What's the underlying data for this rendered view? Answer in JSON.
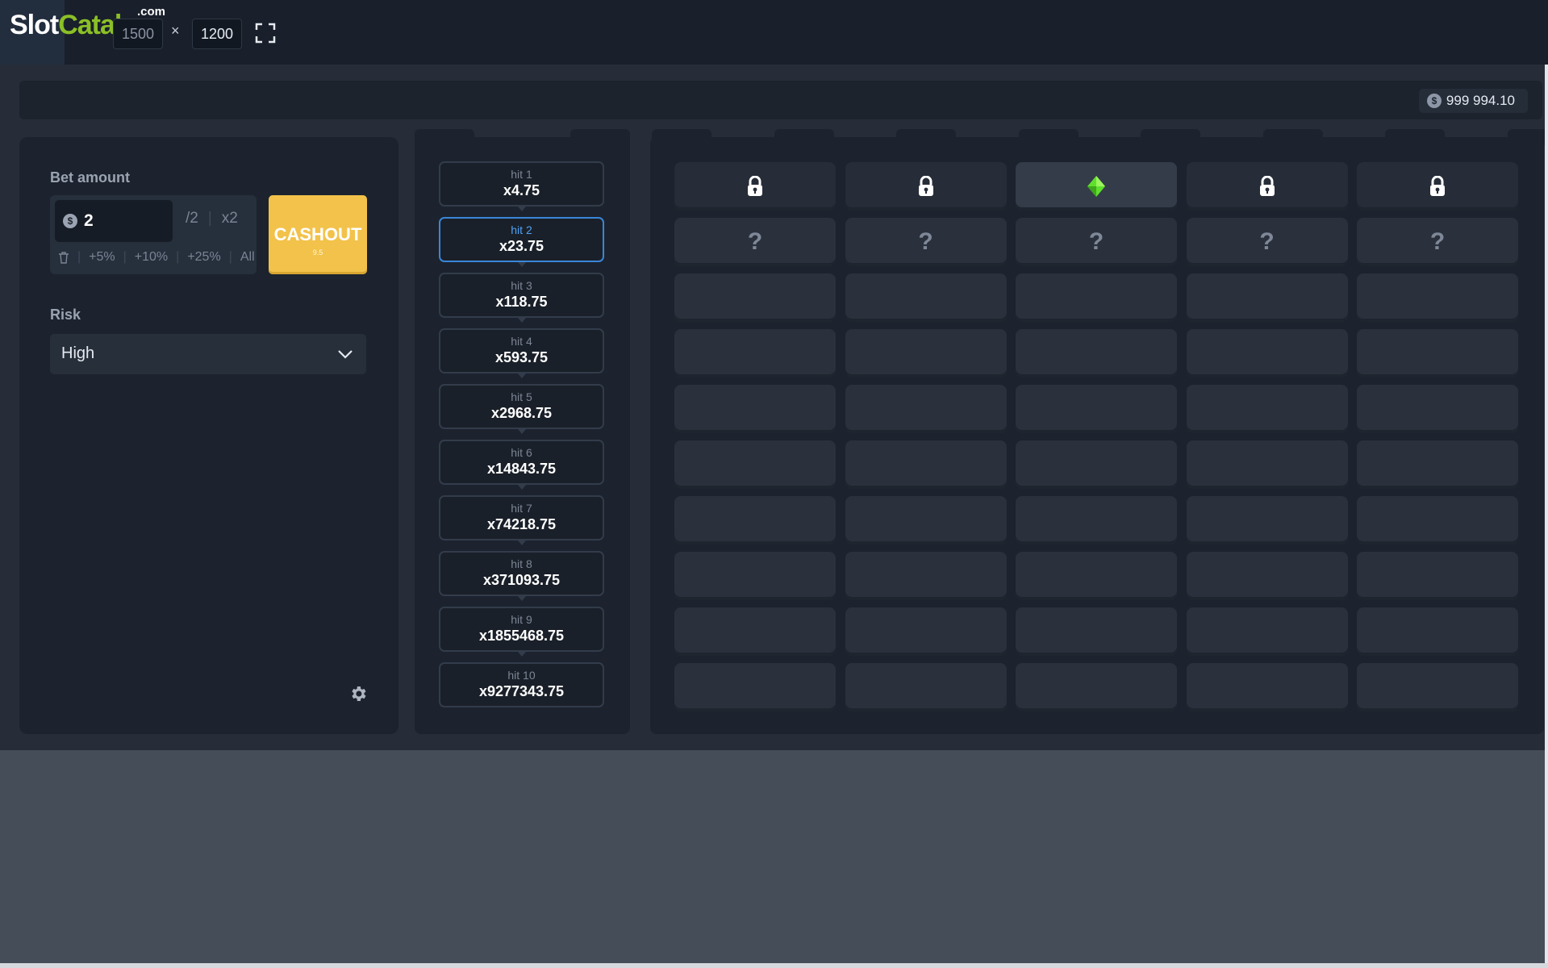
{
  "topbar": {
    "logo_slot": "Slot",
    "logo_catalog": "Catalog",
    "logo_dotcom": ".com",
    "width_value": "1500",
    "times": "×",
    "height_value": "1200",
    "fullscreen_icon": "fullscreen-icon"
  },
  "header": {
    "currency_symbol": "$",
    "balance": "999 994.10"
  },
  "bet": {
    "label": "Bet amount",
    "currency_symbol": "$",
    "amount": "2",
    "half_label": "/2",
    "double_label": "x2",
    "pct5": "+5%",
    "pct10": "+10%",
    "pct25": "+25%",
    "all": "All",
    "cashout_label": "CASHOUT",
    "cashout_sub": "9.5"
  },
  "risk": {
    "label": "Risk",
    "selected": "High"
  },
  "hits": [
    {
      "label": "hit 1",
      "mult": "x4.75"
    },
    {
      "label": "hit 2",
      "mult": "x23.75"
    },
    {
      "label": "hit 3",
      "mult": "x118.75"
    },
    {
      "label": "hit 4",
      "mult": "x593.75"
    },
    {
      "label": "hit 5",
      "mult": "x2968.75"
    },
    {
      "label": "hit 6",
      "mult": "x14843.75"
    },
    {
      "label": "hit 7",
      "mult": "x74218.75"
    },
    {
      "label": "hit 8",
      "mult": "x371093.75"
    },
    {
      "label": "hit 9",
      "mult": "x1855468.75"
    },
    {
      "label": "hit 10",
      "mult": "x9277343.75"
    }
  ],
  "active_hit": 1,
  "grid": {
    "columns": 5,
    "rows": 10,
    "header_icons": [
      "lock-icon",
      "lock-icon",
      "gem-icon",
      "lock-icon",
      "lock-icon"
    ],
    "highlight_column": 2,
    "unknown_mark": "?",
    "accent_color": "#3a86d8",
    "gem_color": "#5fe02c",
    "cashout_color": "#f2c24a"
  }
}
